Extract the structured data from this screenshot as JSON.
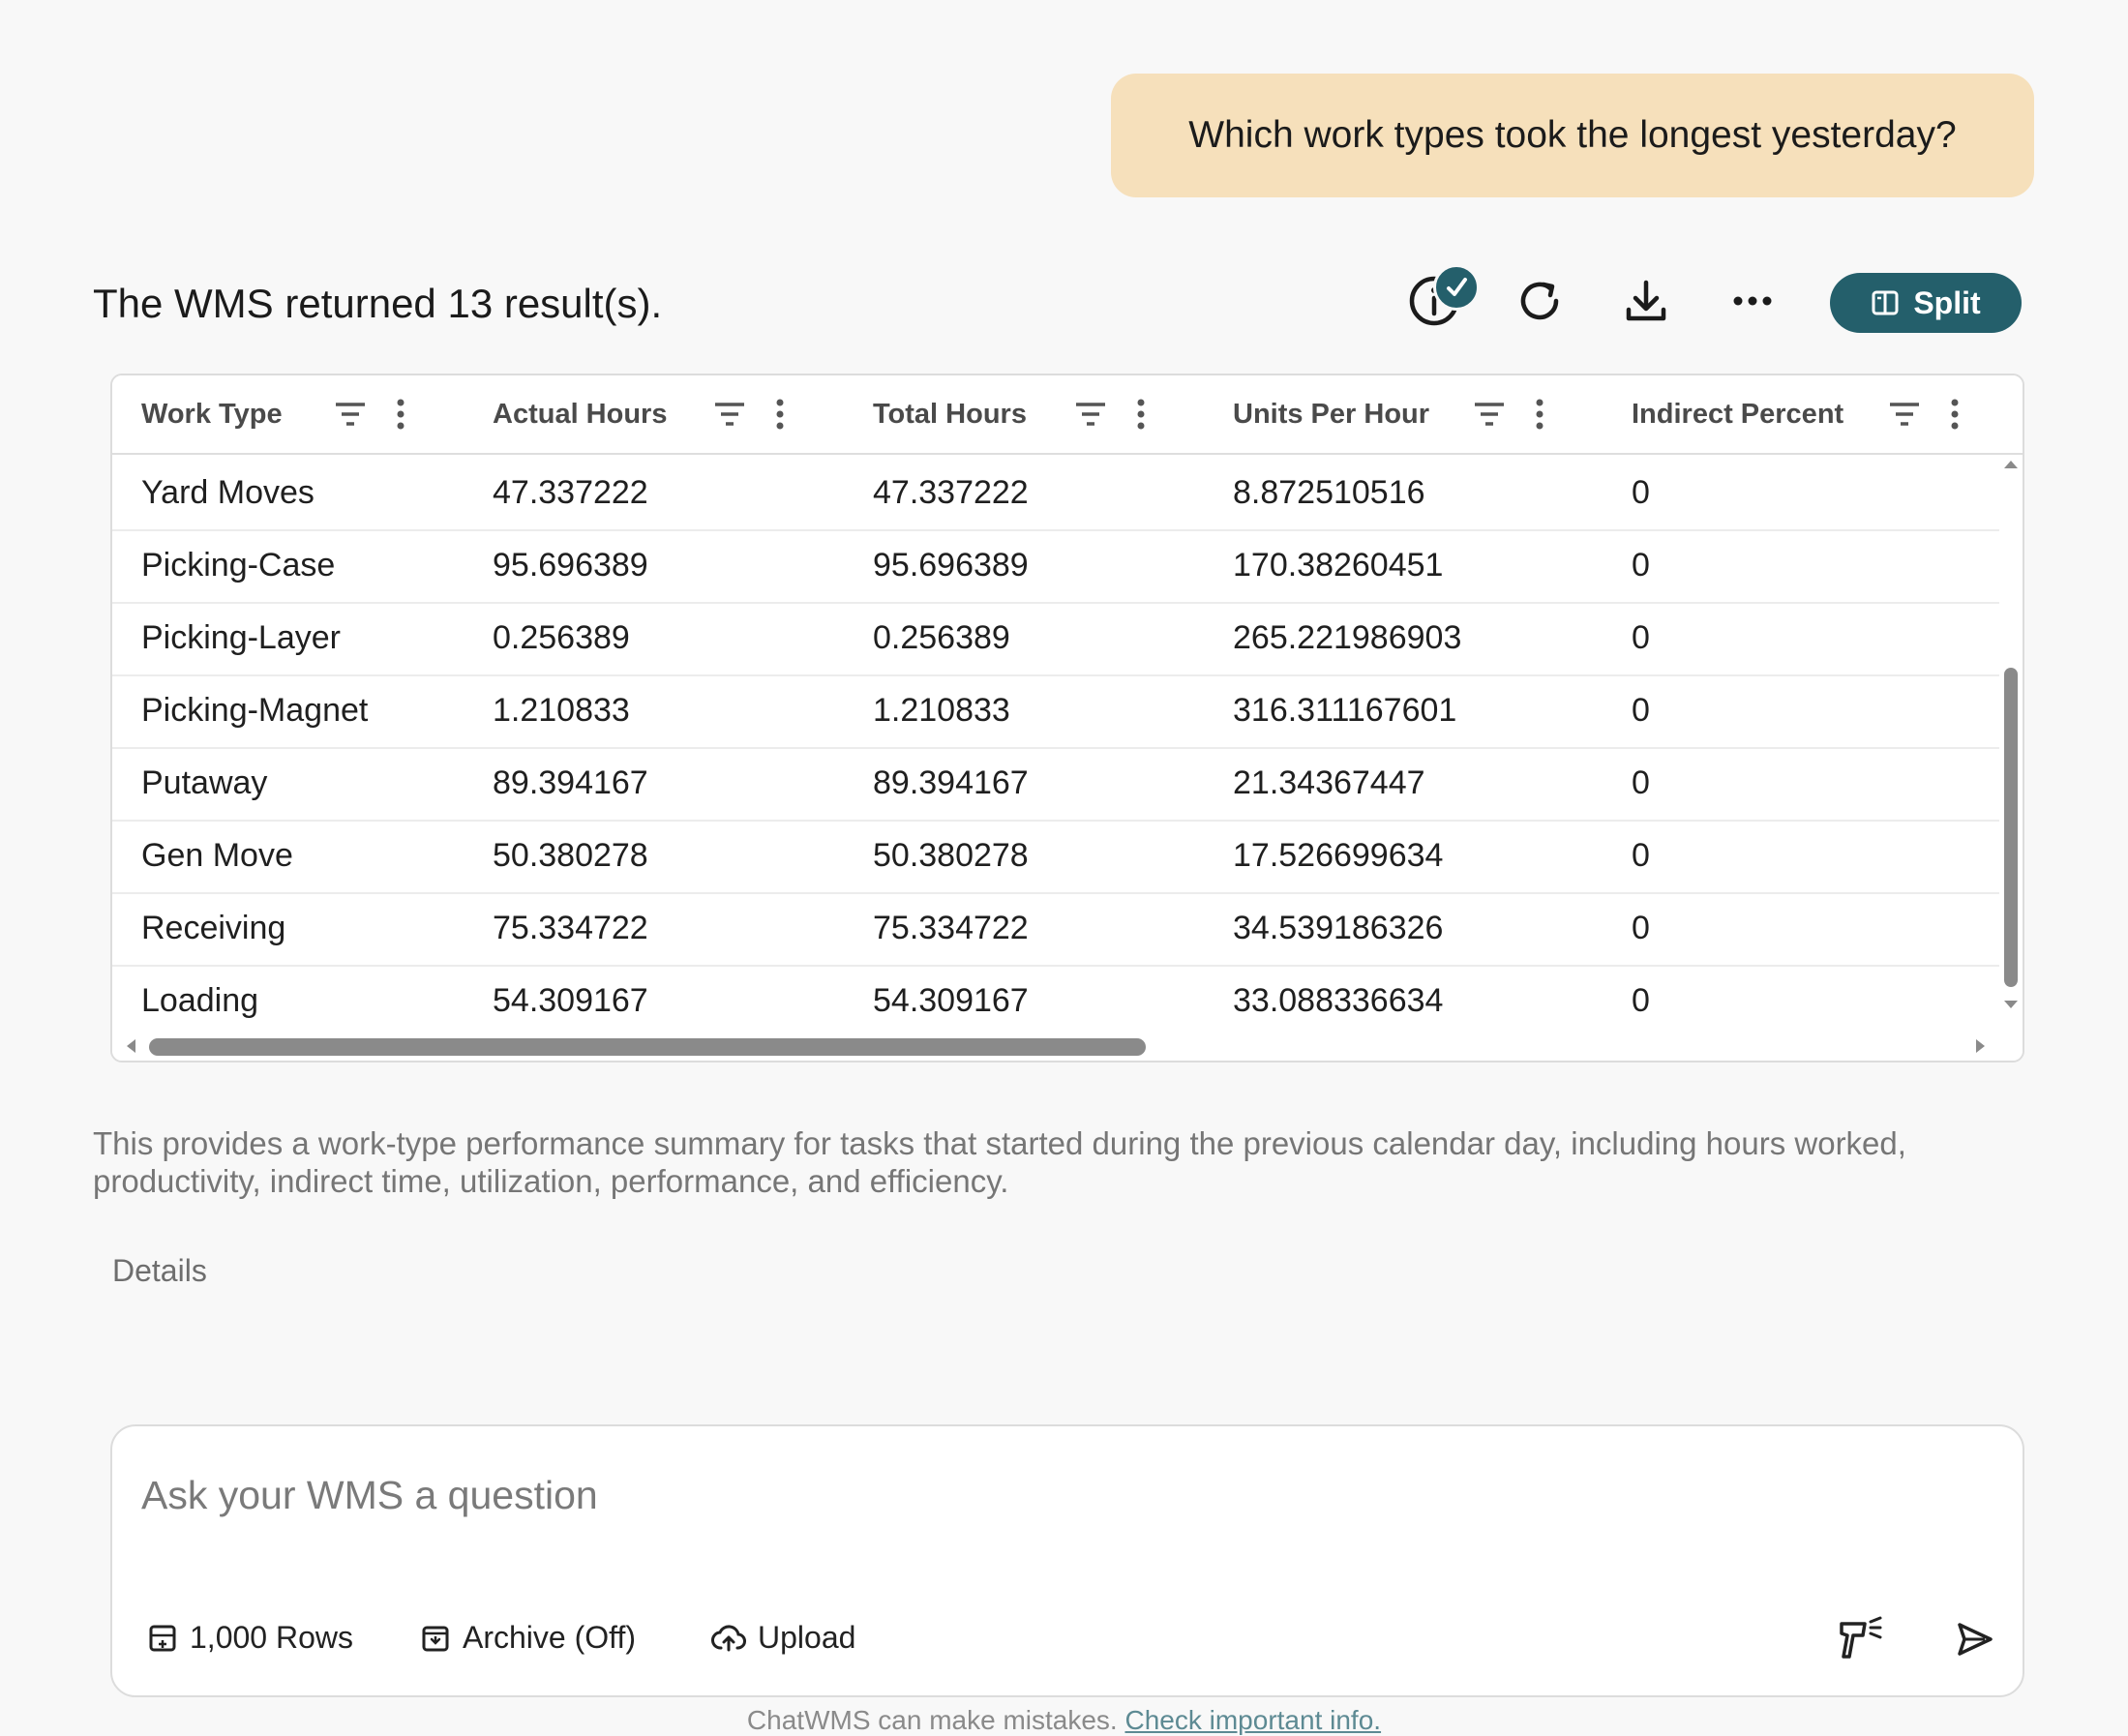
{
  "chat": {
    "user_message": "Which work types took the longest yesterday?"
  },
  "response": {
    "summary": "The WMS returned 13 result(s).",
    "split_label": "Split",
    "description": "This provides a work-type performance summary for tasks that started during the previous calendar day, including hours worked, productivity, indirect time, utilization, performance, and efficiency.",
    "details_label": "Details"
  },
  "table": {
    "columns": [
      "Work Type",
      "Actual Hours",
      "Total Hours",
      "Units Per Hour",
      "Indirect Percent"
    ],
    "rows": [
      [
        "Yard Moves",
        "47.337222",
        "47.337222",
        "8.872510516",
        "0"
      ],
      [
        "Picking-Case",
        "95.696389",
        "95.696389",
        "170.38260451",
        "0"
      ],
      [
        "Picking-Layer",
        "0.256389",
        "0.256389",
        "265.221986903",
        "0"
      ],
      [
        "Picking-Magnet",
        "1.210833",
        "1.210833",
        "316.311167601",
        "0"
      ],
      [
        "Putaway",
        "89.394167",
        "89.394167",
        "21.34367447",
        "0"
      ],
      [
        "Gen Move",
        "50.380278",
        "50.380278",
        "17.526699634",
        "0"
      ],
      [
        "Receiving",
        "75.334722",
        "75.334722",
        "34.539186326",
        "0"
      ],
      [
        "Loading",
        "54.309167",
        "54.309167",
        "33.088336634",
        "0"
      ]
    ]
  },
  "composer": {
    "placeholder": "Ask your WMS a question",
    "rows_label": "1,000 Rows",
    "archive_label": "Archive (Off)",
    "upload_label": "Upload"
  },
  "footer": {
    "note": "ChatWMS can make mistakes.",
    "link": "Check important info."
  },
  "colors": {
    "accent": "#245f6b",
    "user_bubble": "#f6e0bb",
    "background": "#f8f8f8"
  },
  "icons": {
    "toolbar": [
      "info-icon",
      "check-badge-icon",
      "refresh-icon",
      "download-icon",
      "more-horizontal-icon",
      "split-panel-icon"
    ],
    "column_header": [
      "filter-icon",
      "column-menu-icon"
    ],
    "composer": [
      "rows-icon",
      "archive-icon",
      "upload-cloud-icon",
      "scanner-icon",
      "send-icon"
    ]
  }
}
